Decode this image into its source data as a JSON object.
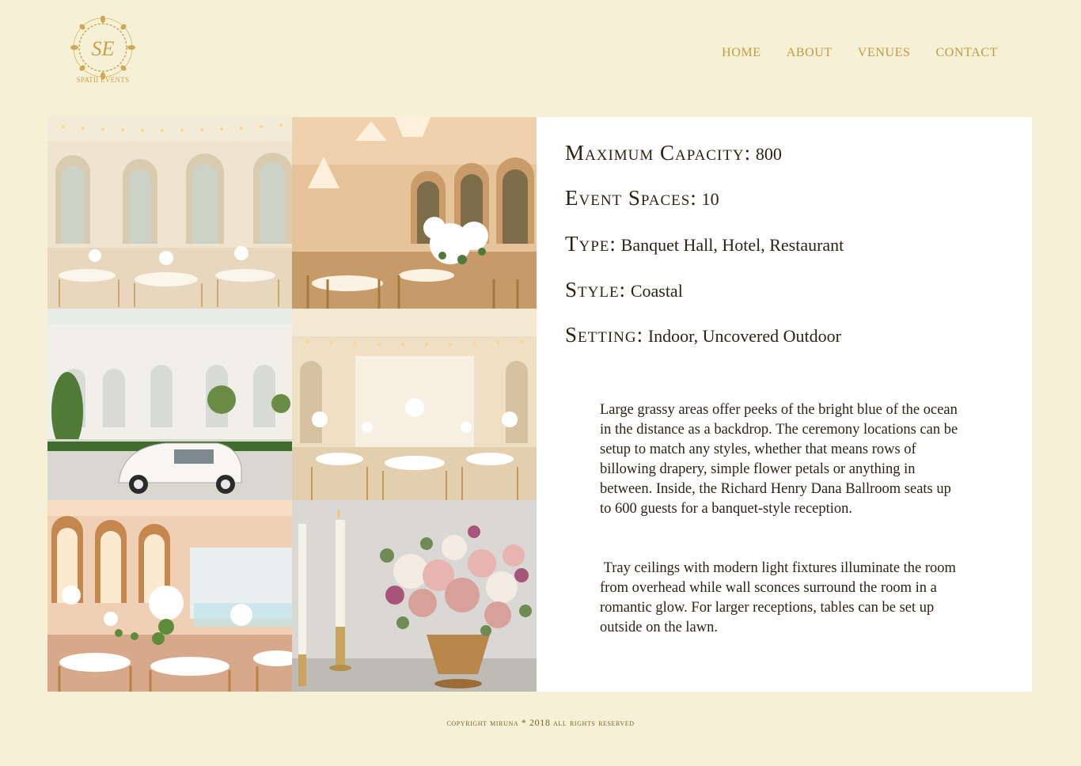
{
  "brand": {
    "monogram": "SE",
    "name": "SPATII EVENTS",
    "gold": "#c9a24a"
  },
  "nav": {
    "items": [
      {
        "label": "HOME"
      },
      {
        "label": "ABOUT"
      },
      {
        "label": "VENUES"
      },
      {
        "label": "CONTACT"
      }
    ]
  },
  "gallery": {
    "photos": [
      {
        "subject": "ballroom-with-mirrors"
      },
      {
        "subject": "chandelier-dining-room"
      },
      {
        "subject": "white-mansion-with-vintage-car"
      },
      {
        "subject": "long-reception-hall"
      },
      {
        "subject": "arched-ballroom-reception"
      },
      {
        "subject": "candles-and-floral-centerpiece"
      }
    ]
  },
  "venue": {
    "facts": [
      {
        "label": "Maximum Capacity:",
        "value": "800"
      },
      {
        "label": "Event Spaces:",
        "value": "10"
      },
      {
        "label": "Type:",
        "value": "Banquet Hall, Hotel, Restaurant"
      },
      {
        "label": "Style:",
        "value": "Coastal"
      },
      {
        "label": "Setting:",
        "value": "Indoor, Uncovered Outdoor"
      }
    ],
    "description": [
      "Large grassy areas offer peeks of  the bright blue of the ocean in the distance as a backdrop. The ceremony locations can be setup to match any styles, whether that means rows of  billowing drapery, simple flower petals or anything in between. Inside, the Richard Henry Dana Ballroom seats up to 600 guests for a banquet-style reception.",
      " Tray ceilings with modern light fixtures illuminate the room from overhead while wall sconces surround the room in a romantic glow. For larger receptions, tables can be set up outside on the lawn."
    ]
  },
  "footer": {
    "text": "copyright miruna * 2018 all rights reserved"
  }
}
